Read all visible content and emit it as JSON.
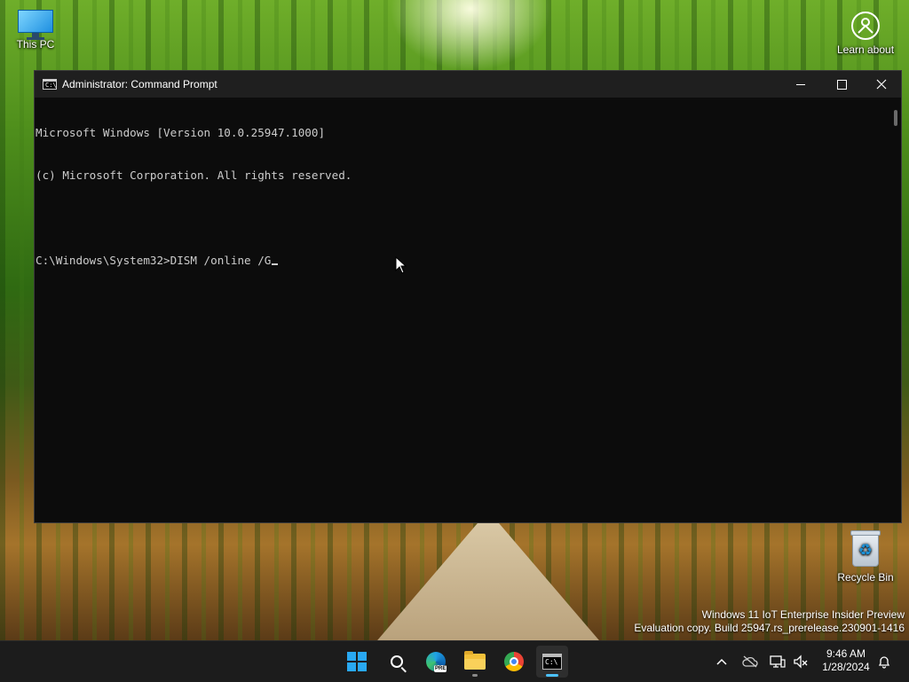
{
  "desktop": {
    "icons": [
      {
        "label": "This PC"
      },
      {
        "label": "Learn about"
      },
      {
        "label": "Recycle Bin"
      }
    ],
    "watermark": {
      "line1": "Windows 11 IoT Enterprise Insider Preview",
      "line2": "Evaluation copy. Build 25947.rs_prerelease.230901-1416"
    }
  },
  "window": {
    "title": "Administrator: Command Prompt",
    "console_lines": [
      "Microsoft Windows [Version 10.0.25947.1000]",
      "(c) Microsoft Corporation. All rights reserved.",
      "",
      "C:\\Windows\\System32>DISM /online /G"
    ],
    "controls": {
      "minimize": "minimize",
      "maximize": "maximize",
      "close": "close"
    }
  },
  "taskbar": {
    "apps": [
      "start",
      "search",
      "edge-preview",
      "file-explorer",
      "chrome",
      "command-prompt"
    ],
    "edge_badge": "PRE",
    "clock": {
      "time": "9:46 AM",
      "date": "1/28/2024"
    }
  },
  "colors": {
    "console_bg": "#0c0c0c",
    "console_text": "#cccccc",
    "taskbar_bg": "#1c1c1c",
    "accent": "#4cc2ff"
  }
}
